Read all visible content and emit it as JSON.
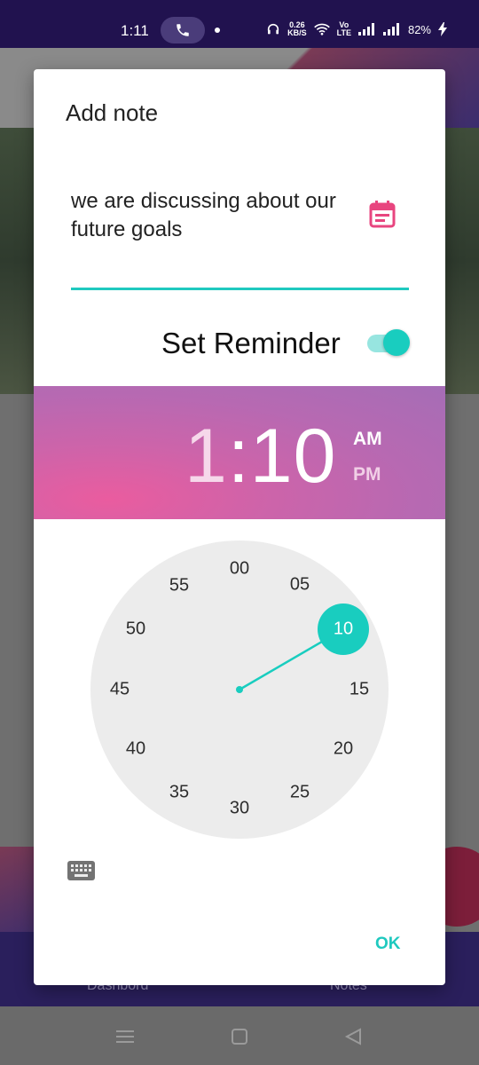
{
  "status_bar": {
    "time": "1:11",
    "data_speed_value": "0.26",
    "data_speed_unit": "KB/S",
    "volte_top": "Vo",
    "volte_bottom": "LTE",
    "battery": "82%"
  },
  "background_app": {
    "nav_left_label": "Dashbord",
    "nav_right_label": "Notes"
  },
  "dialog": {
    "title": "Add note",
    "note_text": "we are discussing about our future goals",
    "reminder_label": "Set Reminder",
    "reminder_enabled": true,
    "time_picker": {
      "hour": "1",
      "separator": ":",
      "minute": "10",
      "am_label": "AM",
      "pm_label": "PM",
      "selected_period": "AM",
      "selected_minute": "10",
      "minute_labels": [
        "00",
        "05",
        "10",
        "15",
        "20",
        "25",
        "30",
        "35",
        "40",
        "45",
        "50",
        "55"
      ]
    },
    "ok_label": "OK"
  },
  "colors": {
    "accent": "#1fc9bf",
    "header_gradient_start": "#ea5c9f",
    "header_gradient_end": "#a56db6",
    "calendar_icon": "#e8457f"
  },
  "icons": {
    "call": "phone-icon",
    "calendar": "calendar-icon",
    "keyboard": "keyboard-icon",
    "nav_recents": "menu-icon",
    "nav_home": "square-icon",
    "nav_back": "triangle-back-icon"
  }
}
